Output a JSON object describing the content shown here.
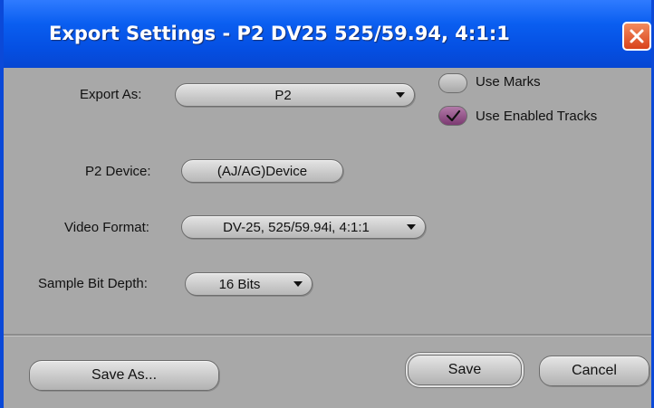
{
  "window": {
    "title": "Export Settings - P2 DV25 525/59.94, 4:1:1"
  },
  "form": {
    "export_as": {
      "label": "Export As:",
      "value": "P2"
    },
    "use_marks": {
      "label": "Use Marks",
      "checked": false
    },
    "use_enabled_tracks": {
      "label": "Use Enabled Tracks",
      "checked": true
    },
    "p2_device": {
      "label": "P2 Device:",
      "value": "(AJ/AG)Device"
    },
    "video_format": {
      "label": "Video Format:",
      "value": "DV-25, 525/59.94i, 4:1:1"
    },
    "sample_bit_depth": {
      "label": "Sample Bit Depth:",
      "value": "16 Bits"
    }
  },
  "buttons": {
    "save_as": "Save As...",
    "save": "Save",
    "cancel": "Cancel"
  },
  "icons": {
    "close": "close-icon",
    "dropdown": "chevron-down-icon",
    "check": "checkmark-icon"
  },
  "colors": {
    "titlebar": "#0550e3",
    "close_button": "#d9421b",
    "dialog_bg": "#a8a8a8",
    "checked_fill": "#7c3a72"
  }
}
